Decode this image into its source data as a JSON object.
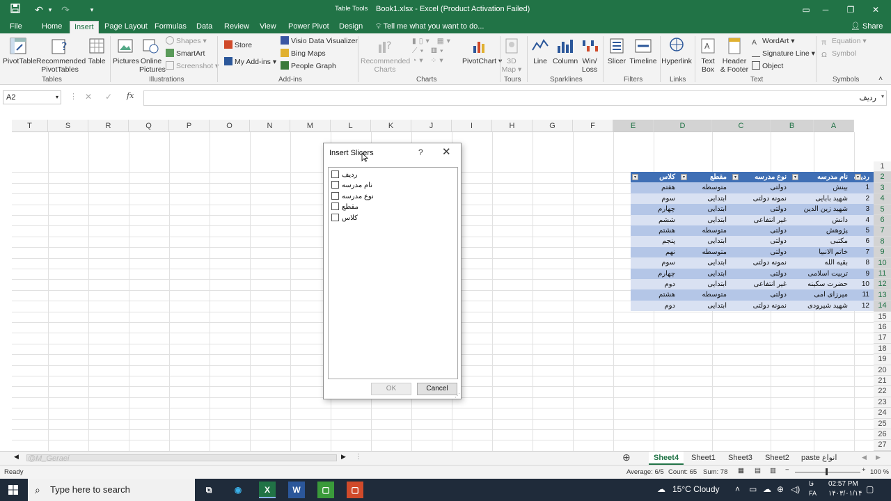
{
  "window": {
    "title": "Book1.xlsx - Excel (Product Activation Failed)",
    "context_label": "Table Tools",
    "watermark": "@M_Geraei"
  },
  "tabs": [
    {
      "label": "File"
    },
    {
      "label": "Home"
    },
    {
      "label": "Insert",
      "active": true
    },
    {
      "label": "Page Layout"
    },
    {
      "label": "Formulas"
    },
    {
      "label": "Data"
    },
    {
      "label": "Review"
    },
    {
      "label": "View"
    },
    {
      "label": "Power Pivot"
    },
    {
      "label": "Design"
    }
  ],
  "tellme": "Tell me what you want to do...",
  "share": "Share",
  "ribbon": {
    "pivottable": "PivotTable",
    "recommended_pivottables": "Recommended",
    "recommended_pivottables_2": "PivotTables",
    "table": "Table",
    "tables_group": "Tables",
    "pictures": "Pictures",
    "online_pictures": "Online",
    "online_pictures_2": "Pictures",
    "shapes": "Shapes",
    "smartart": "SmartArt",
    "screenshot": "Screenshot",
    "illustrations_group": "Illustrations",
    "store": "Store",
    "my_addins": "My Add-ins",
    "visio": "Visio Data Visualizer",
    "bing_maps": "Bing Maps",
    "people_graph": "People Graph",
    "addins_group": "Add-ins",
    "recommended_charts": "Recommended",
    "recommended_charts_2": "Charts",
    "pivotchart": "PivotChart",
    "charts_group": "Charts",
    "map3d": "3D",
    "map3d_2": "Map",
    "tours_group": "Tours",
    "line": "Line",
    "column": "Column",
    "winloss": "Win/",
    "winloss_2": "Loss",
    "sparklines_group": "Sparklines",
    "slicer": "Slicer",
    "timeline": "Timeline",
    "filters_group": "Filters",
    "hyperlink": "Hyperlink",
    "links_group": "Links",
    "textbox": "Text",
    "textbox_2": "Box",
    "header_footer": "Header",
    "header_footer_2": "& Footer",
    "wordart": "WordArt",
    "signature_line": "Signature Line",
    "object": "Object",
    "text_group": "Text",
    "equation": "Equation",
    "symbol": "Symbol",
    "symbols_group": "Symbols"
  },
  "formula": {
    "namebox": "A2",
    "fx": "fx",
    "value": "ردیف"
  },
  "columns": [
    "T",
    "S",
    "R",
    "Q",
    "P",
    "O",
    "N",
    "M",
    "L",
    "K",
    "J",
    "I",
    "H",
    "G",
    "F",
    "E",
    "D",
    "C",
    "B",
    "A"
  ],
  "rows": [
    "1",
    "2",
    "3",
    "4",
    "5",
    "6",
    "7",
    "8",
    "9",
    "10",
    "11",
    "12",
    "13",
    "14",
    "15",
    "16",
    "17",
    "18",
    "19",
    "20",
    "21",
    "22",
    "23",
    "24",
    "25",
    "26",
    "27"
  ],
  "table": {
    "headers": [
      "ردیف",
      "نام مدرسه",
      "نوع مدرسه",
      "مقطع",
      "کلاس"
    ],
    "rows": [
      [
        "1",
        "بینش",
        "دولتی",
        "متوسطه",
        "هفتم"
      ],
      [
        "2",
        "شهید بابایی",
        "نمونه دولتی",
        "ابتدایی",
        "سوم"
      ],
      [
        "3",
        "شهید زین الدین",
        "دولتی",
        "ابتدایی",
        "چهارم"
      ],
      [
        "4",
        "دانش",
        "غیر انتفاعی",
        "ابتدایی",
        "ششم"
      ],
      [
        "5",
        "پژوهش",
        "دولتی",
        "متوسطه",
        "هشتم"
      ],
      [
        "6",
        "مکتبی",
        "دولتی",
        "ابتدایی",
        "پنجم"
      ],
      [
        "7",
        "خاتم الانبیا",
        "دولتی",
        "متوسطه",
        "نهم"
      ],
      [
        "8",
        "بقیه الله",
        "نمونه دولتی",
        "ابتدایی",
        "سوم"
      ],
      [
        "9",
        "تربیت اسلامی",
        "دولتی",
        "ابتدایی",
        "چهارم"
      ],
      [
        "10",
        "حضرت سکینه",
        "غیر انتفاعی",
        "ابتدایی",
        "دوم"
      ],
      [
        "11",
        "میرزای امی",
        "دولتی",
        "متوسطه",
        "هشتم"
      ],
      [
        "12",
        "شهید شیرودی",
        "نمونه دولتی",
        "ابتدایی",
        "دوم"
      ]
    ]
  },
  "dialog": {
    "title": "Insert Slicers",
    "help": "?",
    "close": "✕",
    "fields": [
      "ردیف",
      "نام مدرسه",
      "نوع مدرسه",
      "مقطع",
      "کلاس"
    ],
    "ok": "OK",
    "cancel": "Cancel"
  },
  "sheets": [
    {
      "label": "Sheet4",
      "active": true
    },
    {
      "label": "Sheet1"
    },
    {
      "label": "Sheet3"
    },
    {
      "label": "Sheet2"
    },
    {
      "label": "paste انواع"
    }
  ],
  "status": {
    "ready": "Ready",
    "average": "Average: 6/5",
    "count": "Count: 65",
    "sum": "Sum: 78",
    "zoom": "100 %"
  },
  "taskbar": {
    "search": "Type here to search",
    "weather": "15°C  Cloudy",
    "time": "02:57 PM",
    "date": "۱۴۰۳/۰۱/۱۴",
    "lang": "FA",
    "lang2": "فا"
  },
  "colors": {
    "excel_green": "#217346",
    "table_header": "#3f6fb5",
    "band_dark": "#b4c6e7",
    "band_light": "#d9e1f2"
  }
}
